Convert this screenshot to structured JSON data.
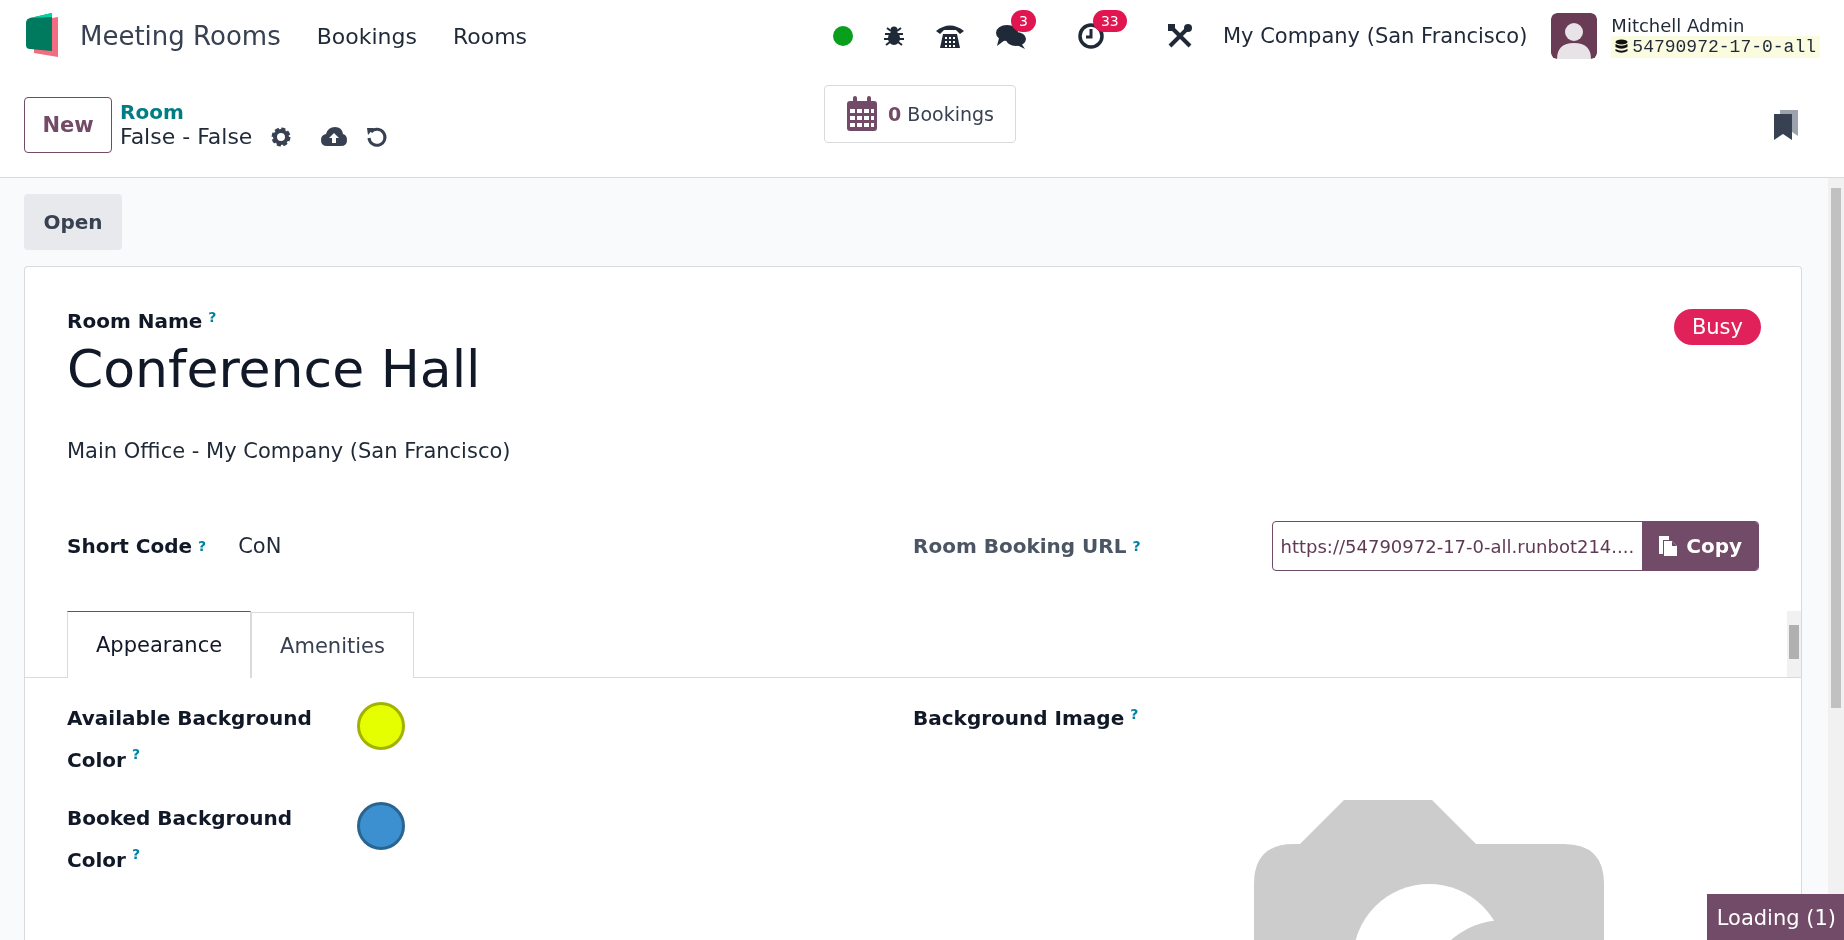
{
  "navbar": {
    "app_name": "Meeting Rooms",
    "menu": [
      "Bookings",
      "Rooms"
    ],
    "messages_count": "3",
    "activities_count": "33",
    "company": "My Company (San Francisco)",
    "user": {
      "name": "Mitchell Admin",
      "database": "54790972-17-0-all"
    }
  },
  "control_panel": {
    "new_button": "New",
    "breadcrumb": "Room",
    "record_title": "False - False",
    "smart_button": {
      "count": "0",
      "label": "Bookings"
    }
  },
  "status_button": "Open",
  "form": {
    "name_label": "Room Name",
    "name_help": "?",
    "name": "Conference Hall",
    "location": "Main Office - My Company (San Francisco)",
    "status_badge": "Busy",
    "short_code": {
      "label": "Short Code",
      "help": "?",
      "value": "CoN"
    },
    "booking_url": {
      "label": "Room Booking URL",
      "help": "?",
      "value": "https://54790972-17-0-all.runbot214....",
      "copy_button": "Copy"
    },
    "tabs": [
      {
        "label": "Appearance",
        "selected": true
      },
      {
        "label": "Amenities",
        "selected": false
      }
    ],
    "color_fields": [
      {
        "label": "Available Background Color",
        "help": "?",
        "color": "#e6ff00"
      },
      {
        "label": "Booked Background Color",
        "help": "?",
        "color": "#3c90d0"
      }
    ],
    "image_field": {
      "label": "Background Image",
      "help": "?"
    }
  },
  "loading": "Loading (1)"
}
